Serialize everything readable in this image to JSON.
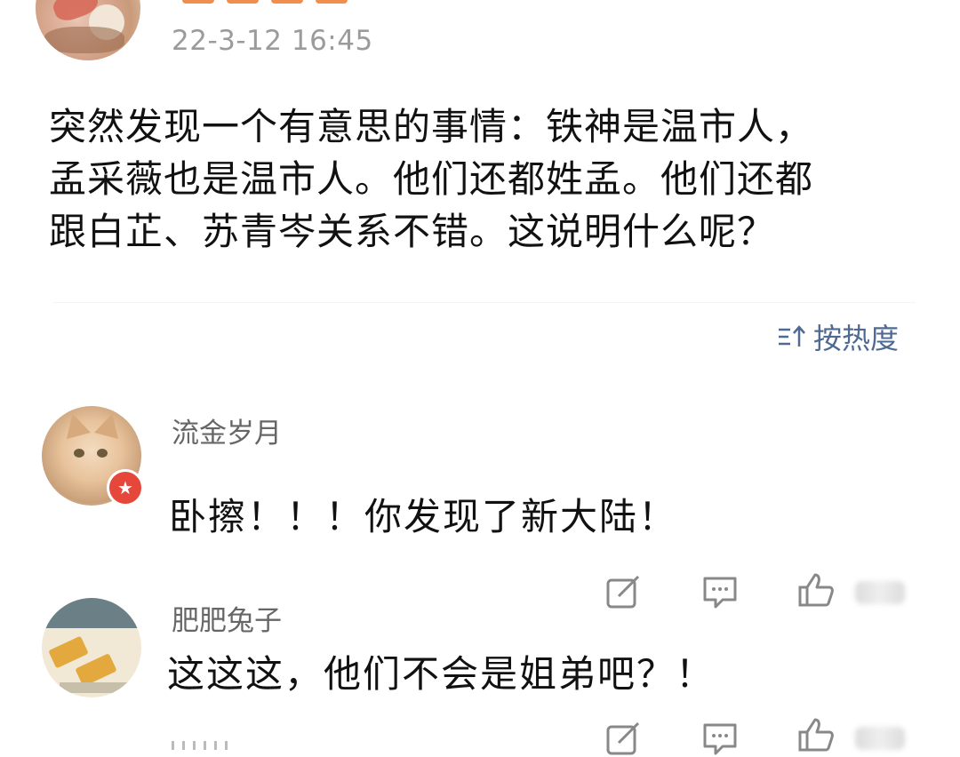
{
  "post": {
    "timestamp": "22-3-12 16:45",
    "body_lines": [
      "突然发现一个有意思的事情：铁神是温市人，",
      "孟采薇也是温市人。他们还都姓孟。他们还都",
      "跟白芷、苏青岑关系不错。这说明什么呢？"
    ]
  },
  "sort": {
    "label": "按热度",
    "icon": "sort-icon"
  },
  "comments": [
    {
      "user": "流金岁月",
      "text": "卧擦！！！你发现了新大陆！",
      "avatar": "cat-avatar",
      "badge": "star-badge-icon"
    },
    {
      "user": "肥肥兔子",
      "text": "这这这，他们不会是姐弟吧？！",
      "avatar": "cartoon-avatar"
    }
  ],
  "actions": [
    "repost-icon",
    "comment-icon",
    "like-icon"
  ],
  "colors": {
    "link": "#4f6a92",
    "muted": "#9b9b9b",
    "badge": "#e5483b"
  }
}
